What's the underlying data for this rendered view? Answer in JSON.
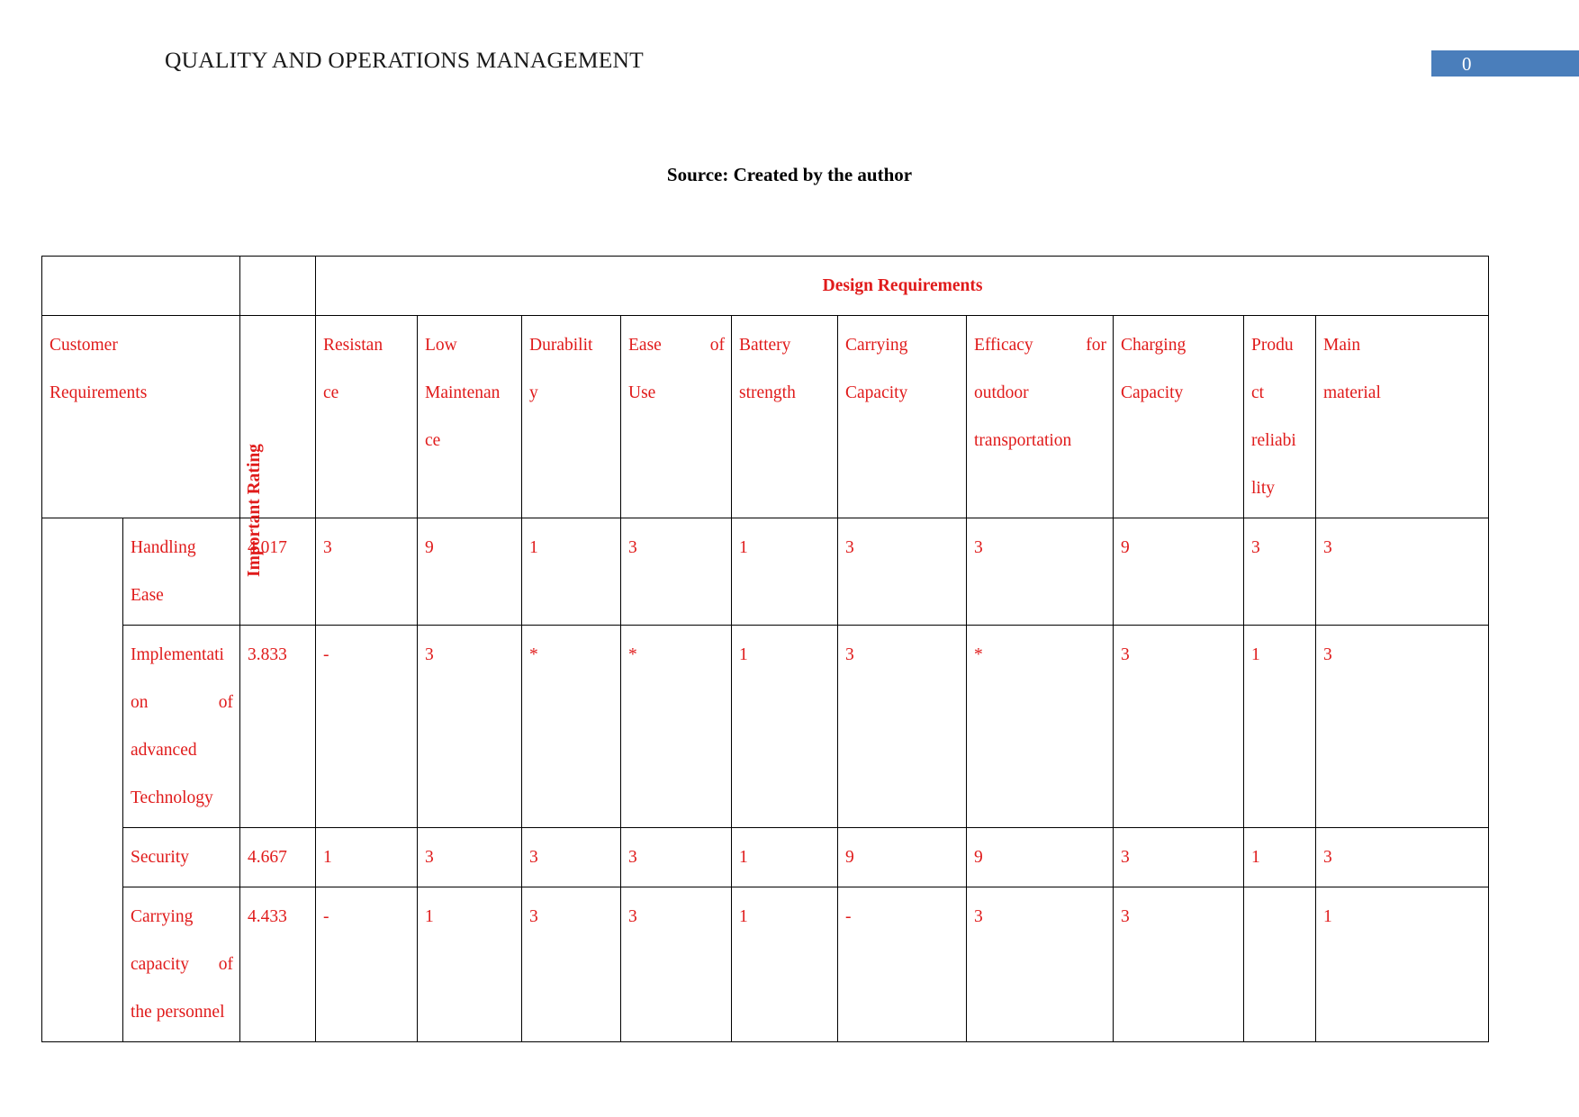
{
  "header": {
    "title": "QUALITY AND OPERATIONS MANAGEMENT",
    "page_number": "0",
    "badge_color": "#4a7ebb"
  },
  "caption": "Source: Created by the author",
  "table": {
    "accent_color": "#e01b1b",
    "group_header": "Design Requirements",
    "corner_label_line1": "Customer",
    "corner_label_line2": "Requirements",
    "rotated_header": "Important Rating",
    "column_headers": [
      {
        "l1": "Resistan",
        "l2": "ce",
        "l3": "",
        "l4": "",
        "justify": false
      },
      {
        "l1": "Low",
        "l2": "Maintenan",
        "l3": "ce",
        "l4": "",
        "justify": false
      },
      {
        "l1": "Durabilit",
        "l2": "y",
        "l3": "",
        "l4": "",
        "justify": false
      },
      {
        "l1": "Ease of",
        "l2": "Use",
        "l3": "",
        "l4": "",
        "justify": true
      },
      {
        "l1": "Battery",
        "l2": "strength",
        "l3": "",
        "l4": "",
        "justify": false
      },
      {
        "l1": "Carrying",
        "l2": "Capacity",
        "l3": "",
        "l4": "",
        "justify": false
      },
      {
        "l1": "Efficacy for",
        "l2": "outdoor",
        "l3": "transportation",
        "l4": "",
        "justify": true
      },
      {
        "l1": "Charging",
        "l2": "Capacity",
        "l3": "",
        "l4": "",
        "justify": false
      },
      {
        "l1": "Produ",
        "l2": "ct",
        "l3": "reliabi",
        "l4": "lity",
        "justify": false
      },
      {
        "l1": "Main",
        "l2": "material",
        "l3": "",
        "l4": "",
        "justify": false
      }
    ],
    "rows": [
      {
        "label_lines": [
          "Handling",
          "Ease"
        ],
        "label_justify": false,
        "rating": "4.017",
        "values": [
          "3",
          "9",
          "1",
          "3",
          "1",
          "3",
          "3",
          "9",
          "3",
          "3"
        ]
      },
      {
        "label_lines": [
          "Implementati",
          "on of",
          "advanced",
          "Technology"
        ],
        "label_justify": true,
        "rating": "3.833",
        "values": [
          "-",
          "3",
          "*",
          "*",
          "1",
          "3",
          "*",
          "3",
          "1",
          "3"
        ]
      },
      {
        "label_lines": [
          "Security"
        ],
        "label_justify": false,
        "rating": "4.667",
        "values": [
          "1",
          "3",
          "3",
          "3",
          "1",
          "9",
          "9",
          "3",
          "1",
          "3"
        ]
      },
      {
        "label_lines": [
          "Carrying",
          "capacity of",
          "the personnel"
        ],
        "label_justify": true,
        "rating": "4.433",
        "values": [
          "-",
          "1",
          "3",
          "3",
          "1",
          "-",
          "3",
          "3",
          "",
          "1"
        ]
      }
    ]
  }
}
